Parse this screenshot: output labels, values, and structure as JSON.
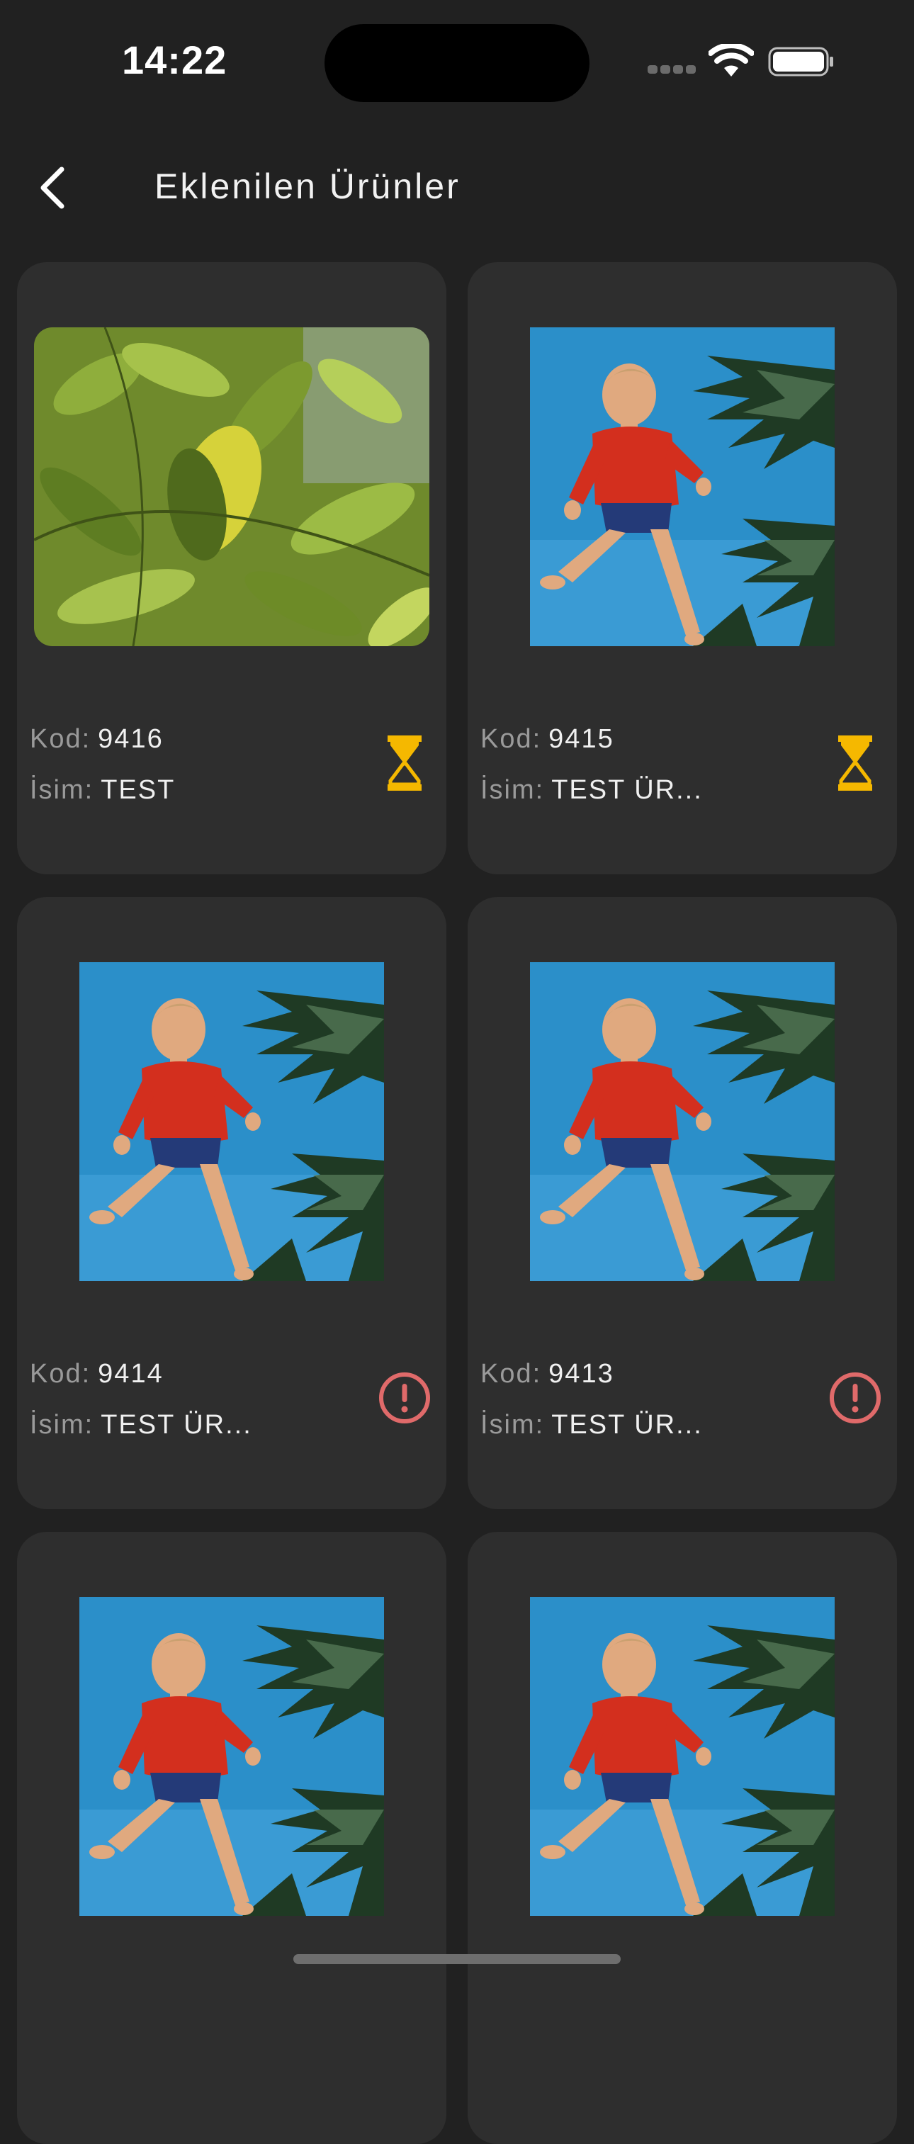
{
  "status_bar": {
    "time": "14:22",
    "icons": [
      "signal-icon",
      "wifi-icon",
      "battery-icon"
    ]
  },
  "header": {
    "back_icon": "chevron-left-icon",
    "title": "Eklenilen Ürünler"
  },
  "labels": {
    "kod": "Kod:",
    "isim": "İsim:"
  },
  "colors": {
    "background": "#212121",
    "card": "#2e2e2e",
    "pending": "#f5b800",
    "error": "#e06a6a"
  },
  "products": [
    {
      "kod": "9416",
      "isim": "TEST",
      "status": "pending",
      "status_icon": "hourglass-icon",
      "image": "plant-leaves-photo"
    },
    {
      "kod": "9415",
      "isim": "TEST ÜR...",
      "status": "pending",
      "status_icon": "hourglass-icon",
      "image": "child-jumping-palm-photo"
    },
    {
      "kod": "9414",
      "isim": "TEST ÜR...",
      "status": "error",
      "status_icon": "exclamation-circle-icon",
      "image": "child-jumping-palm-photo"
    },
    {
      "kod": "9413",
      "isim": "TEST ÜR...",
      "status": "error",
      "status_icon": "exclamation-circle-icon",
      "image": "child-jumping-palm-photo"
    },
    {
      "image": "child-jumping-palm-photo"
    },
    {
      "image": "child-jumping-palm-photo"
    }
  ]
}
